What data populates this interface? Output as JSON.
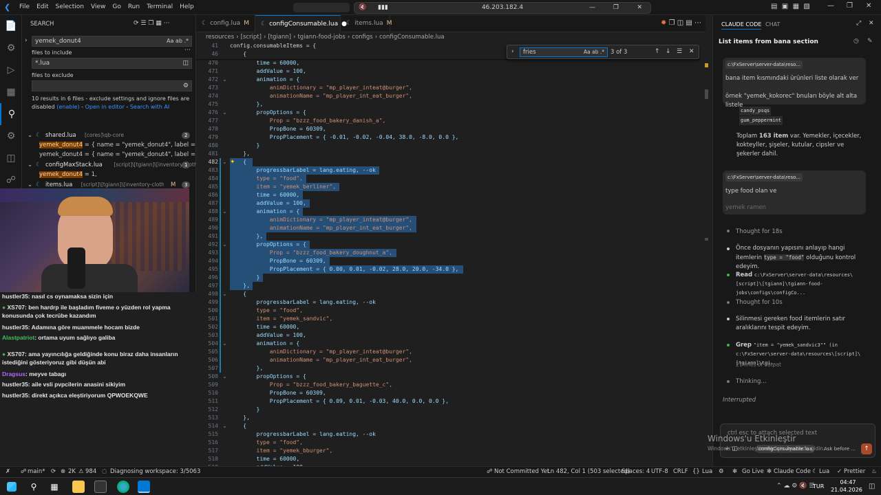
{
  "titlebar": {
    "menu": [
      "File",
      "Edit",
      "Selection",
      "View",
      "Go",
      "Run",
      "Terminal",
      "Help"
    ],
    "center_text": "46.203.182.4"
  },
  "sidebar": {
    "header": "SEARCH",
    "search_value": "yemek_donut4",
    "files_include_label": "files to include",
    "files_include_value": "*.lua",
    "files_exclude_label": "files to exclude",
    "result_summary": "10 results in 6 files - exclude settings and ignore files are disabled",
    "enable_link": "(enable)",
    "open_editor_link": "Open in editor",
    "search_ai_link": "Search with AI",
    "tree": [
      {
        "type": "file",
        "name": "shared.lua",
        "path": "[cores]\\qb-core",
        "count": "2"
      },
      {
        "type": "match",
        "pre": "",
        "hl": "yemek_donut4",
        "post": "= { name = \"yemek_donut4\", label = ..."
      },
      {
        "type": "match",
        "pre": "yemek_donut4",
        "hl": "",
        "post": "= { name = \"yemek_donut4\", label = ..."
      },
      {
        "type": "file",
        "name": "configMaxStack.lua",
        "path": "[script]\\[tgiann]\\[inventory-clothi...",
        "count": "1"
      },
      {
        "type": "match",
        "pre": "",
        "hl": "yemek_donut4",
        "post": "= 1,"
      },
      {
        "type": "file",
        "name": "items.lua",
        "path": "[script]\\[tgiann]\\[inventory-clothing]\\t...",
        "modified": "M",
        "count": "3"
      },
      {
        "type": "match",
        "pre": "",
        "hl": "yemek_donut4",
        "post": "= {"
      }
    ]
  },
  "chat": [
    {
      "user": "hustler35",
      "color": "#e6e6e6",
      "text": ": nasıl cs oynamaksa sizin için",
      "badge": false
    },
    {
      "user": "XS707",
      "color": "#e6e6e6",
      "text": ": ben hardrp ile başladım fiveme o yüzden rol yapma konusunda çok tecrübe kazandım",
      "badge": true
    },
    {
      "user": "hustler35",
      "color": "#e6e6e6",
      "text": ": Adamına göre muammele hocam bizde",
      "badge": false
    },
    {
      "user": "Alastpatriot",
      "color": "#3fbf5f",
      "text": ": ortama uyum sağlıyo galiba",
      "badge": false
    },
    {
      "user": "XS707",
      "color": "#e6e6e6",
      "text": ": ama yayıncılığa geldiğinde konu biraz daha insanların istediğini gösteriyoruz gibi düşün abi",
      "badge": true
    },
    {
      "user": "Dragsus",
      "color": "#b266ff",
      "text": ": meyve tabagı",
      "badge": false
    },
    {
      "user": "hustler35",
      "color": "#e6e6e6",
      "text": ": aile vsli pvpcilerin anasini sikiyim",
      "badge": false
    },
    {
      "user": "hustler35",
      "color": "#e6e6e6",
      "text": ": direkt açıkca eleştiriyorum QPWOEKQWE",
      "badge": false
    }
  ],
  "tabs": [
    {
      "label": "config.lua",
      "mod": "M",
      "active": false
    },
    {
      "label": "configConsumable.lua",
      "mod": "●",
      "active": true
    },
    {
      "label": "items.lua",
      "mod": "M",
      "active": false
    }
  ],
  "breadcrumb": [
    "resources",
    "[script]",
    "[tgiann]",
    "tgiann-food-jobs",
    "configs",
    "configConsumable.lua"
  ],
  "find": {
    "value": "fries",
    "result": "3 of 3"
  },
  "editor": {
    "sticky": [
      {
        "n": "41",
        "t": "config.consumableItems = {"
      },
      {
        "n": "46",
        "t": "    {"
      }
    ],
    "lines": [
      {
        "n": "470",
        "t": "        time = 60000,",
        "sel": false
      },
      {
        "n": "471",
        "t": "        addValue = 100,",
        "sel": false
      },
      {
        "n": "472",
        "t": "        animation = {",
        "sel": false
      },
      {
        "n": "473",
        "t": "            animDictionary = \"mp_player_inteat@burger\",",
        "sel": false
      },
      {
        "n": "474",
        "t": "            animationName = \"mp_player_int_eat_burger\",",
        "sel": false
      },
      {
        "n": "475",
        "t": "        },",
        "sel": false
      },
      {
        "n": "476",
        "t": "        propOptions = {",
        "sel": false
      },
      {
        "n": "477",
        "t": "            Prop = \"bzzz_food_bakery_danish_a\",",
        "sel": false
      },
      {
        "n": "478",
        "t": "            PropBone = 60309,",
        "sel": false
      },
      {
        "n": "479",
        "t": "            PropPlacement = { -0.01, -0.02, -0.04, 38.0, -8.0, 0.0 },",
        "sel": false
      },
      {
        "n": "480",
        "t": "        }",
        "sel": false
      },
      {
        "n": "481",
        "t": "    },",
        "sel": false
      },
      {
        "n": "482",
        "t": "    {",
        "sel": true
      },
      {
        "n": "483",
        "t": "        progressbarLabel = lang.eating, --ok",
        "sel": true
      },
      {
        "n": "484",
        "t": "        type = \"food\",",
        "sel": true
      },
      {
        "n": "485",
        "t": "        item = \"yemek_berliner\",",
        "sel": true
      },
      {
        "n": "486",
        "t": "        time = 60000,",
        "sel": true
      },
      {
        "n": "487",
        "t": "        addValue = 100,",
        "sel": true
      },
      {
        "n": "488",
        "t": "        animation = {",
        "sel": true
      },
      {
        "n": "489",
        "t": "            animDictionary = \"mp_player_inteat@burger\",",
        "sel": true
      },
      {
        "n": "490",
        "t": "            animationName = \"mp_player_int_eat_burger\",",
        "sel": true
      },
      {
        "n": "491",
        "t": "        },",
        "sel": true
      },
      {
        "n": "492",
        "t": "        propOptions = {",
        "sel": true
      },
      {
        "n": "493",
        "t": "            Prop = \"bzzz_food_bakery_doughnut_a\",",
        "sel": true
      },
      {
        "n": "494",
        "t": "            PropBone = 60309,",
        "sel": true
      },
      {
        "n": "495",
        "t": "            PropPlacement = { 0.00, 0.01, -0.02, 28.0, 20.0, -34.0 },",
        "sel": true
      },
      {
        "n": "496",
        "t": "        }",
        "sel": true
      },
      {
        "n": "497",
        "t": "    },",
        "sel": true
      },
      {
        "n": "498",
        "t": "    {",
        "sel": false
      },
      {
        "n": "499",
        "t": "        progressbarLabel = lang.eating, --ok",
        "sel": false
      },
      {
        "n": "500",
        "t": "        type = \"food\",",
        "sel": false
      },
      {
        "n": "501",
        "t": "        item = \"yemek_sandvic\",",
        "sel": false
      },
      {
        "n": "502",
        "t": "        time = 60000,",
        "sel": false
      },
      {
        "n": "503",
        "t": "        addValue = 100,",
        "sel": false
      },
      {
        "n": "504",
        "t": "        animation = {",
        "sel": false
      },
      {
        "n": "505",
        "t": "            animDictionary = \"mp_player_inteat@burger\",",
        "sel": false
      },
      {
        "n": "506",
        "t": "            animationName = \"mp_player_int_eat_burger\",",
        "sel": false
      },
      {
        "n": "507",
        "t": "        },",
        "sel": false
      },
      {
        "n": "508",
        "t": "        propOptions = {",
        "sel": false
      },
      {
        "n": "509",
        "t": "            Prop = \"bzzz_food_bakery_baguette_c\",",
        "sel": false
      },
      {
        "n": "510",
        "t": "            PropBone = 60309,",
        "sel": false
      },
      {
        "n": "511",
        "t": "            PropPlacement = { 0.09, 0.01, -0.03, 40.0, 0.0, 0.0 },",
        "sel": false
      },
      {
        "n": "512",
        "t": "        }",
        "sel": false
      },
      {
        "n": "513",
        "t": "    },",
        "sel": false
      },
      {
        "n": "514",
        "t": "    {",
        "sel": false
      },
      {
        "n": "515",
        "t": "        progressbarLabel = lang.eating, --ok",
        "sel": false
      },
      {
        "n": "516",
        "t": "        type = \"food\",",
        "sel": false
      },
      {
        "n": "517",
        "t": "        item = \"yemek_bburger\",",
        "sel": false
      },
      {
        "n": "518",
        "t": "        time = 60000,",
        "sel": false
      },
      {
        "n": "519",
        "t": "        addValue = 100,",
        "sel": false
      }
    ]
  },
  "claude": {
    "tab_active": "CLAUDE CODE",
    "tab_other": "CHAT",
    "title": "List items from bana section",
    "path_chip": "c:\\FxServer\\server-data\\reso...",
    "msg1_line1": "bana item kısmındaki ürünleri liste olarak ver",
    "msg1_line2": "örnek \"yemek_kokorec\" bnuları böyle alt alta listele",
    "items_tail": [
      "candy_psqs",
      "gum_peppermint"
    ],
    "summary_pre": "Toplam ",
    "summary_bold": "163 item",
    "summary_post": " var. Yemekler, içecekler, kokteyller, şişeler, kutular, cipsler ve şekerler dahil.",
    "msg2_line1": "type food olan ve",
    "msg2_line2": "yemek ramen",
    "thought1": "Thought for 18s",
    "step1_pre": "Önce dosyanın yapısını anlayıp hangi itemlerin ",
    "step1_code": "type = \"food\"",
    "step1_post": " olduğunu kontrol edeyim.",
    "read_label": "Read",
    "read_path": "c:\\FxServer\\server-data\\resources\\[script]\\[tgiann]\\tgiann-food-jobs\\configs\\configCo...",
    "thought2": "Thought for 10s",
    "step2": "Silinmesi gereken food itemlerin satır aralıklarını tespit edeyim.",
    "grep_label": "Grep",
    "grep_text": "\"item = \"yemek_sandvic3\"\" (in c:\\FxServer\\server-data\\resources\\[script]\\[tgiann]\\tgi...",
    "grep_sub": "21 lines of output",
    "thinking": "Thinking...",
    "interrupted": "Interrupted",
    "input_placeholder": "ctrl esc to attach selected text",
    "input_chip": "configConsumable.lua",
    "mode_label": "Ask before ..."
  },
  "watermark": {
    "line1": "Windows'u Etkinleştir",
    "line2": "Windows'u etkinleştirmek için Ayarlar'a gidin."
  },
  "statusbar": {
    "branch": "main*",
    "problems": "2K",
    "warnings": "984",
    "diagnosing": "Diagnosing workspace: 3/5063",
    "vcs": "Not Committed Yet",
    "position": "Ln 482, Col 1 (503 selected)",
    "spaces": "Spaces: 4",
    "encoding": "UTF-8",
    "eol": "CRLF",
    "language": "Lua",
    "golive": "Go Live",
    "claude": "Claude Code",
    "lua2": "Lua",
    "prettier": "Prettier"
  },
  "taskbar": {
    "lang": "TUR",
    "time": "04:47",
    "date": "21.04.2026"
  },
  "colors": {
    "accent": "#0078d4",
    "selection": "#264f78",
    "match_hl": "#7a3b00"
  }
}
